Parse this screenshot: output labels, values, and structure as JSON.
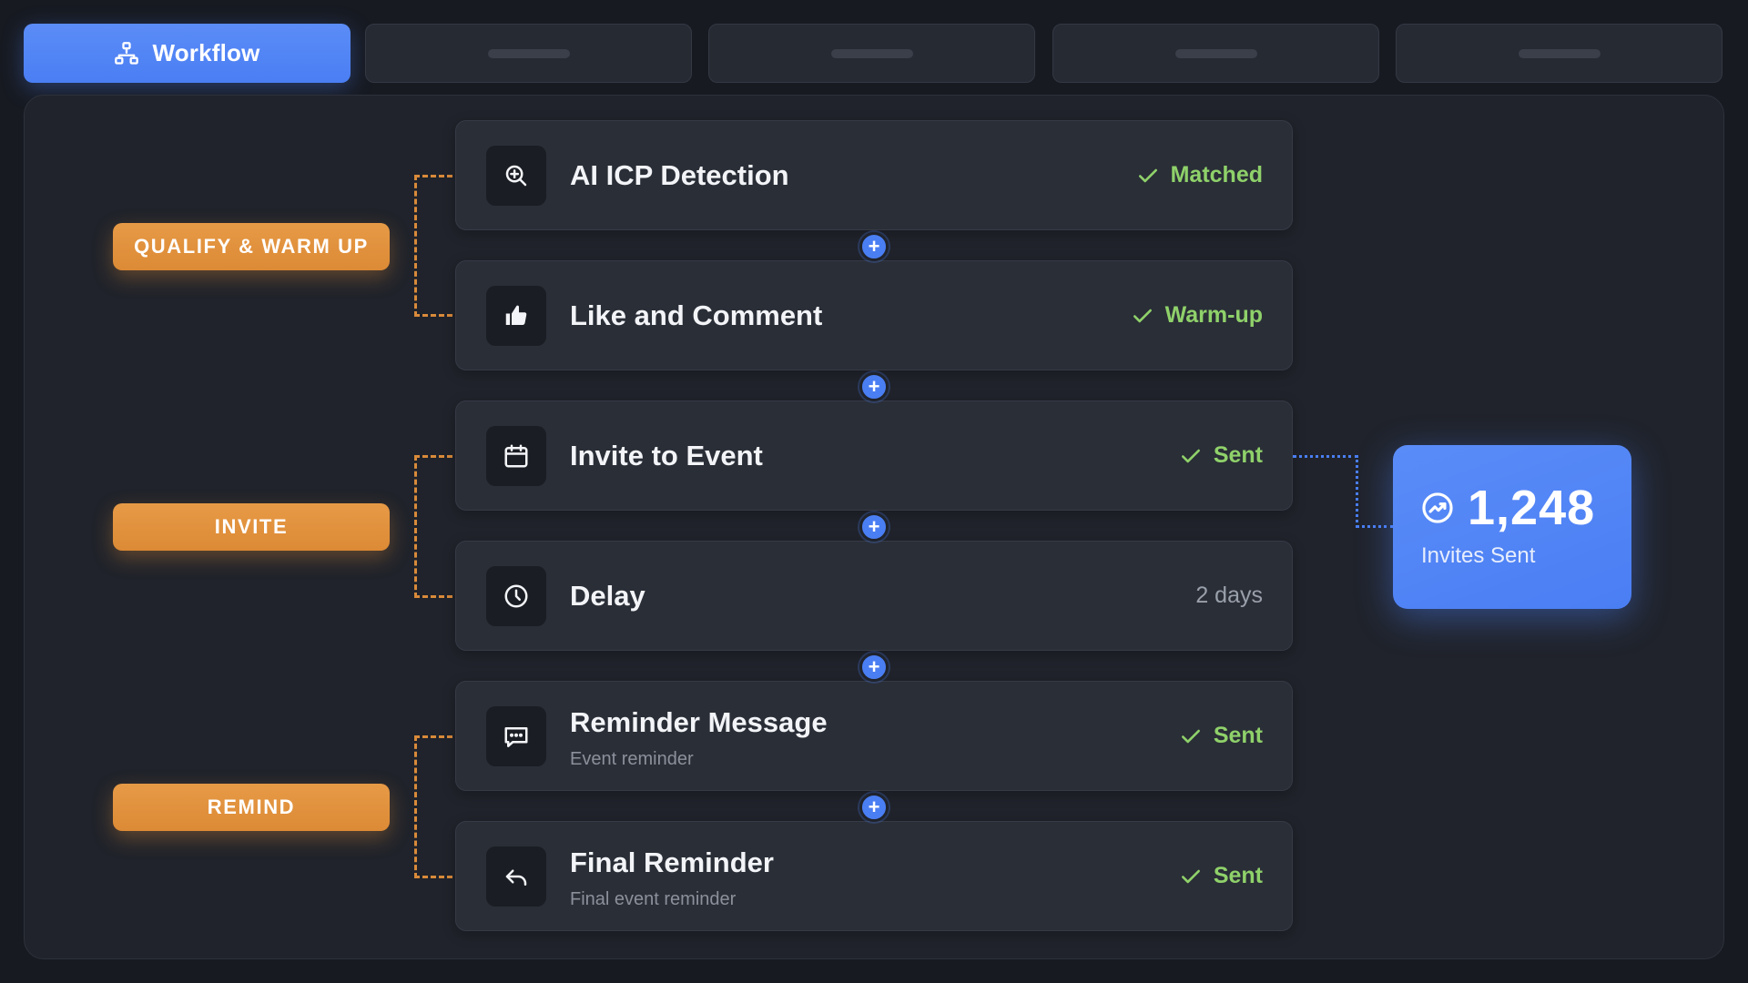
{
  "tabs": [
    {
      "label": "Workflow",
      "icon": "workflow-icon",
      "active": true
    },
    {
      "label": "",
      "active": false
    },
    {
      "label": "",
      "active": false
    },
    {
      "label": "",
      "active": false
    },
    {
      "label": "",
      "active": false
    }
  ],
  "stages": [
    {
      "label": "QUALIFY & WARM UP"
    },
    {
      "label": "INVITE"
    },
    {
      "label": "REMIND"
    }
  ],
  "steps": [
    {
      "title": "AI ICP Detection",
      "subtitle": "",
      "status": "Matched",
      "status_checked": true,
      "icon": "zoom-in-icon"
    },
    {
      "title": "Like and Comment",
      "subtitle": "",
      "status": "Warm-up",
      "status_checked": true,
      "icon": "thumbs-up-icon"
    },
    {
      "title": "Invite to Event",
      "subtitle": "",
      "status": "Sent",
      "status_checked": true,
      "icon": "calendar-icon"
    },
    {
      "title": "Delay",
      "subtitle": "",
      "status": "2 days",
      "status_checked": false,
      "icon": "clock-icon"
    },
    {
      "title": "Reminder Message",
      "subtitle": "Event reminder",
      "status": "Sent",
      "status_checked": true,
      "icon": "message-icon"
    },
    {
      "title": "Final Reminder",
      "subtitle": "Final event reminder",
      "status": "Sent",
      "status_checked": true,
      "icon": "reply-icon"
    }
  ],
  "metric": {
    "value": "1,248",
    "label": "Invites Sent",
    "icon": "trend-up-icon"
  },
  "colors": {
    "accent_blue": "#4a7ef3",
    "stage_orange": "#dc8a35",
    "status_green": "#8fd16a",
    "background": "#171a21",
    "panel": "#20232b",
    "card": "#2a2e37"
  }
}
